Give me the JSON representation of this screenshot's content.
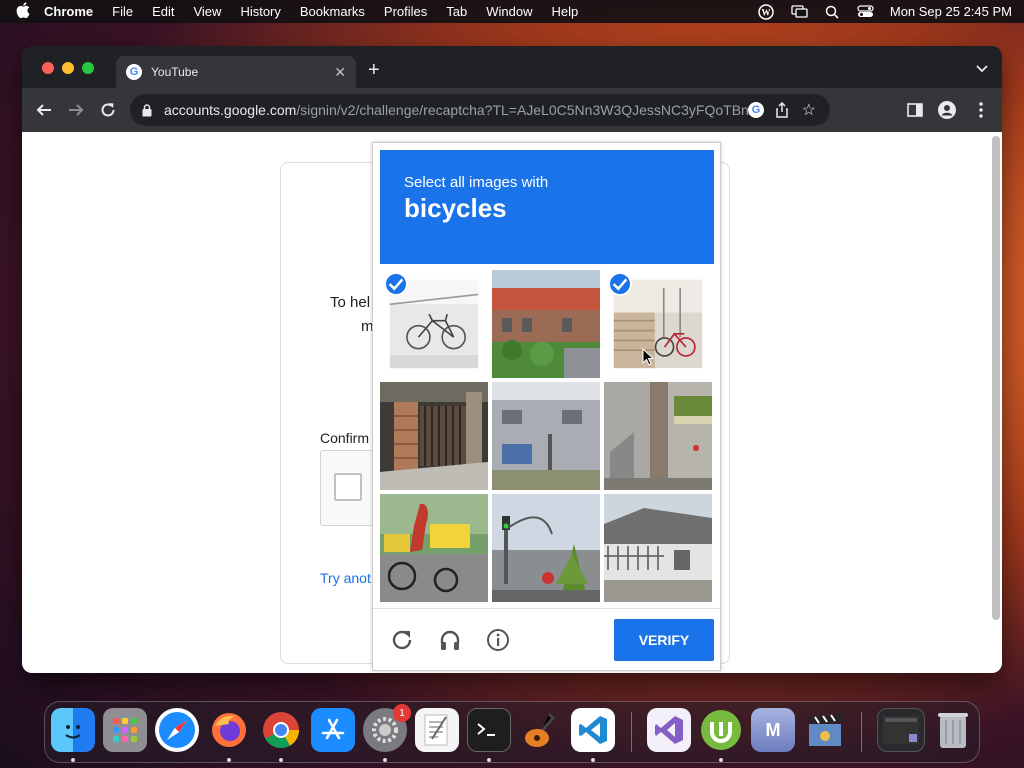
{
  "menubar": {
    "app_name": "Chrome",
    "items": [
      "File",
      "Edit",
      "View",
      "History",
      "Bookmarks",
      "Profiles",
      "Tab",
      "Window",
      "Help"
    ],
    "datetime": "Mon Sep 25  2:45 PM"
  },
  "browser": {
    "tab_title": "YouTube",
    "url_host": "accounts.google.com",
    "url_path": "/signin/v2/challenge/recaptcha?TL=AJeL0C5Nn3W3QJessNC3yFQoTBn..."
  },
  "signin": {
    "line1": "To hel",
    "line2": "m",
    "confirm_label": "Confirm",
    "try_link": "Try anot"
  },
  "captcha": {
    "instruction": "Select all images with",
    "target": "bicycles",
    "verify_label": "VERIFY",
    "tiles": [
      {
        "name": "bicycle-on-snow",
        "selected": true
      },
      {
        "name": "red-roof-building",
        "selected": false
      },
      {
        "name": "bicycle-by-stairs",
        "selected": true
      },
      {
        "name": "gate-shadow",
        "selected": false
      },
      {
        "name": "grey-building",
        "selected": false
      },
      {
        "name": "tree-and-shop",
        "selected": false
      },
      {
        "name": "cyclist-with-cargo",
        "selected": false
      },
      {
        "name": "traffic-light-street",
        "selected": false
      },
      {
        "name": "house-with-fence",
        "selected": false
      }
    ]
  },
  "dock": {
    "apps": [
      "Finder",
      "Launchpad",
      "Safari",
      "Firefox",
      "Chrome",
      "App Store",
      "System Settings",
      "TextEdit",
      "Terminal",
      "GarageBand",
      "VS Code",
      "Visual Studio",
      "uTorrent",
      "Mail M",
      "Claquette",
      "Screenshot",
      "Trash"
    ],
    "settings_badge": "1",
    "letter_m": "M"
  },
  "colors": {
    "accent": "#1a73e8",
    "menubar_bg": "#141014",
    "toolbar_bg": "#35363a"
  }
}
